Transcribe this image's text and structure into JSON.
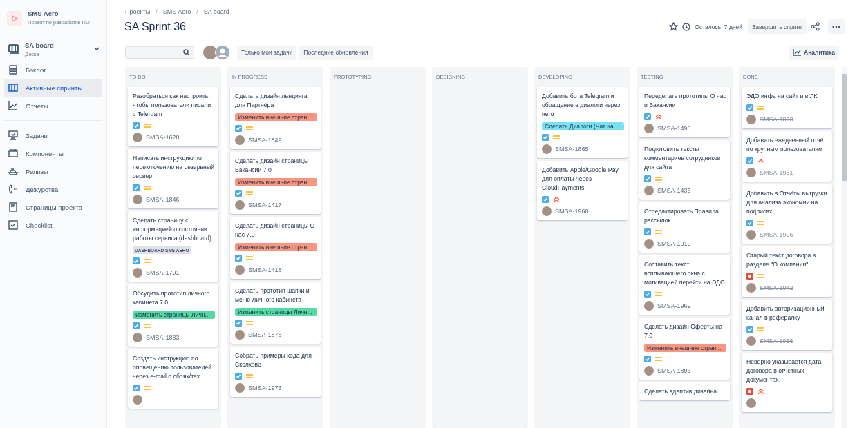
{
  "project": {
    "name": "SMS Aero",
    "subtitle": "Проект по разработке ПО"
  },
  "board_switch": {
    "name": "SA board",
    "subtitle": "Доска"
  },
  "sidebar": {
    "items": [
      {
        "label": "Бэклог",
        "kind": "backlog",
        "selected": false
      },
      {
        "label": "Активные спринты",
        "kind": "sprint",
        "selected": true
      },
      {
        "label": "Отчеты",
        "kind": "reports",
        "selected": false
      }
    ],
    "items_2": [
      {
        "label": "Задачи",
        "kind": "issues",
        "selected": false
      },
      {
        "label": "Компоненты",
        "kind": "components",
        "selected": false
      },
      {
        "label": "Релизы",
        "kind": "releases",
        "selected": false
      },
      {
        "label": "Дежурства",
        "kind": "oncall",
        "selected": false
      },
      {
        "label": "Страницы проекта",
        "kind": "pages",
        "selected": false
      },
      {
        "label": "Checklist",
        "kind": "checklist",
        "selected": false
      }
    ]
  },
  "breadcrumbs": [
    {
      "kind": "link",
      "text": "Проекты"
    },
    {
      "kind": "separator",
      "text": "/"
    },
    {
      "kind": "link",
      "text": "SMS Aero"
    },
    {
      "kind": "separator",
      "text": "/"
    },
    {
      "kind": "link",
      "text": "SA board"
    }
  ],
  "title": "SA Sprint 36",
  "remaining": "Осталось: 7 дней",
  "complete_button": "Завершить спринт",
  "filters": [
    "Только мои задачи",
    "Последние обновления"
  ],
  "insights_button": "Аналитика",
  "columns": [
    {
      "title": "TO DO",
      "cards": [
        {
          "summary": "Разобраться как настроить, чтобы пользователи писали с Telergam",
          "kind": "task",
          "priority": {
            "kind": "medium"
          },
          "key": "SMSA-1620",
          "resolved": false
        },
        {
          "summary": "Написать инструкцию по переключению на резервный сервер",
          "kind": "task",
          "priority": {
            "kind": "medium"
          },
          "key": "SMSA-1846",
          "resolved": false
        },
        {
          "summary": "Сделать страницу с информацией о состоянии работы сервиса (dashboard)",
          "label": "DASHBOARD SMS AERO",
          "kind": "task",
          "priority": {
            "kind": "medium"
          },
          "key": "SMSA-1791",
          "resolved": false
        },
        {
          "summary": "Обсудить прототип личного кабинета 7.0",
          "epic": {
            "text": "Изменить страницы Личн...",
            "color": "#57d9a3"
          },
          "kind": "task",
          "priority": {
            "kind": "medium"
          },
          "key": "SMSA-1883",
          "resolved": false
        },
        {
          "summary": "Создать инструкцию по оповещению пользователей через e-mail о сбоях/тех.",
          "kind": "task",
          "priority": {
            "kind": "medium"
          }
        }
      ]
    },
    {
      "title": "IN PROGRESS",
      "cards": [
        {
          "summary": "Сделать дизайн лендинга для Партнёра",
          "epic": {
            "text": "Изменить внешние стран...",
            "color": "#f99681"
          },
          "kind": "task",
          "priority": {
            "kind": "medium"
          },
          "key": "SMSA-1849",
          "resolved": false
        },
        {
          "summary": "Сделать дизайн страницы Вакансии 7.0",
          "epic": {
            "text": "Изменить внешние стран...",
            "color": "#f99681"
          },
          "kind": "task",
          "priority": {
            "kind": "medium"
          },
          "key": "SMSA-1417",
          "resolved": false
        },
        {
          "summary": "Сделать дизайн страницы О нас 7.0",
          "epic": {
            "text": "Изменить внешние стран...",
            "color": "#f99681"
          },
          "kind": "task",
          "priority": {
            "kind": "medium"
          },
          "key": "SMSA-1418",
          "resolved": false
        },
        {
          "summary": "Сделать прототип шапки и меню Личного кабинета",
          "epic": {
            "text": "Изменить страницы Личн...",
            "color": "#57d9a3"
          },
          "kind": "task",
          "priority": {
            "kind": "medium"
          },
          "key": "SMSA-1878",
          "resolved": false
        },
        {
          "summary": "Собрать примеры кода для Сколково",
          "kind": "task",
          "priority": {
            "kind": "medium"
          },
          "key": "SMSA-1973",
          "resolved": false
        }
      ]
    },
    {
      "title": "PROTOTYPING"
    },
    {
      "title": "DESIGNING"
    },
    {
      "title": "DEVELOPING",
      "cards": [
        {
          "summary": "Добавить бота Telegram и обращение в диалоги через него",
          "epic": {
            "text": "Сделать Диалоги (Чат на ...",
            "color": "#79e2f2"
          },
          "kind": "task",
          "priority": {
            "kind": "medium"
          },
          "key": "SMSA-1865",
          "resolved": false
        },
        {
          "summary": "Добавить Apple/Google Pay для оплаты через CloudPayments",
          "kind": "task",
          "priority": {
            "kind": "highest"
          },
          "key": "SMSA-1960",
          "resolved": false
        }
      ]
    },
    {
      "title": "TESTING",
      "cards": [
        {
          "summary": "Переделать прототипы О нас и Вакансии",
          "kind": "task",
          "priority": {
            "kind": "highest"
          },
          "key": "SMSA-1498",
          "resolved": false
        },
        {
          "summary": "Подготовить тексты комментариев сотрудников для сайта",
          "kind": "task",
          "priority": {
            "kind": "medium"
          },
          "key": "SMSA-1436",
          "resolved": false
        },
        {
          "summary": "Отредактировать Правила рассылок",
          "kind": "task",
          "priority": {
            "kind": "medium"
          },
          "key": "SMSA-1919",
          "resolved": false
        },
        {
          "summary": "Составить текст всплывающего окна с мотивацией перейти на ЭДО",
          "kind": "task",
          "priority": {
            "kind": "medium"
          },
          "key": "SMSA-1969",
          "resolved": false
        },
        {
          "summary": "Сделать дизайн Оферты на 7.0",
          "epic": {
            "text": "Изменить внешние стран...",
            "color": "#f99681"
          },
          "kind": "task",
          "priority": {
            "kind": "medium"
          },
          "key": "SMSA-1893",
          "resolved": false
        },
        {
          "summary": "Сделать адаптив дизайна"
        }
      ]
    },
    {
      "title": "DONE",
      "cards": [
        {
          "summary": "ЭДО инфа на сайт и в ЛК",
          "kind": "task",
          "priority": {
            "kind": "medium"
          },
          "key": "SMSA-1873",
          "resolved": true
        },
        {
          "summary": "Добавить ежедневный отчёт по крупным пользователям",
          "kind": "task",
          "priority": {
            "kind": "high"
          },
          "key": "SMSA-1961",
          "resolved": true
        },
        {
          "summary": "Добавить в Отчёты выгрузки для анализа экономии на подписях",
          "kind": "task",
          "priority": {
            "kind": "medium"
          },
          "key": "SMSA-1926",
          "resolved": true
        },
        {
          "summary": "Старый текст договора в разделе \"О компании\"",
          "kind": "bug",
          "priority": {
            "kind": "medium"
          },
          "key": "SMSA-1942",
          "resolved": true
        },
        {
          "summary": "Добавить авторизационный канал в рефералку",
          "kind": "task",
          "priority": {
            "kind": "medium"
          },
          "key": "SMSA-1956",
          "resolved": true
        },
        {
          "summary": "Неверно указывается дата договора в отчётных документах.",
          "kind": "bug",
          "priority": {
            "kind": "highest"
          }
        }
      ]
    }
  ]
}
